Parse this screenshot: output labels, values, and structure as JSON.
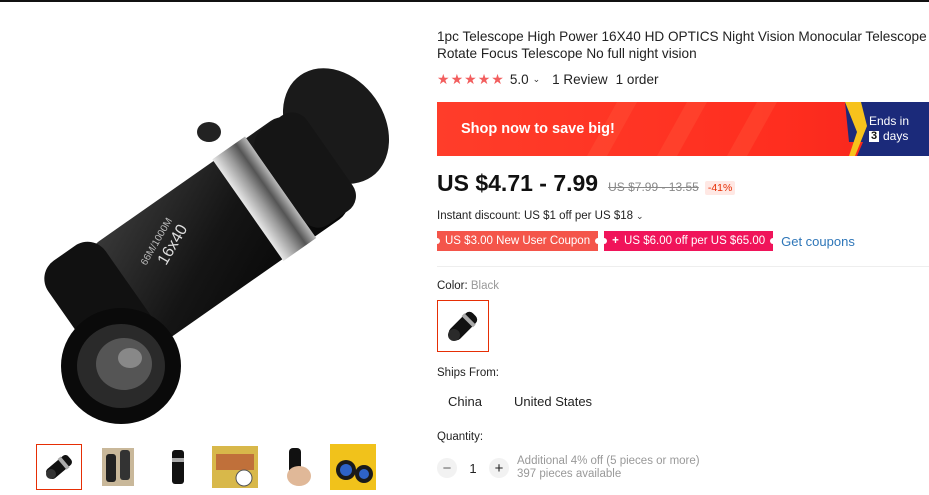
{
  "product": {
    "title": "1pc Telescope High Power 16X40 HD OPTICS Night Vision Monocular Telescope Rotate Focus Telescope No full night vision",
    "rating_score": "5.0",
    "reviews": "1 Review",
    "orders": "1 order"
  },
  "main_image": {
    "lens_text": "16x40",
    "lens_subtext": "66M/1000M"
  },
  "thumbnails": [
    "telescope-front",
    "telescope-pair",
    "telescope-side",
    "telescope-view",
    "telescope-hand",
    "telescope-lens"
  ],
  "promo": {
    "text": "Shop now to save big!",
    "ends_in": "Ends in",
    "days_num": "3",
    "days_label": "days"
  },
  "price": {
    "current": "US $4.71 - 7.99",
    "original": "US $7.99 - 13.55",
    "discount": "-41%"
  },
  "instant_discount": "Instant discount: US $1 off per US $18",
  "coupons": {
    "new_user": "US $3.00 New User Coupon",
    "store_plus": "+",
    "store": "US $6.00 off per US $65.00",
    "get_link": "Get coupons"
  },
  "color": {
    "label": "Color:",
    "value": "Black"
  },
  "ships": {
    "label": "Ships From:",
    "options": [
      "China",
      "United States"
    ]
  },
  "quantity": {
    "label": "Quantity:",
    "value": "1",
    "minus": "−",
    "plus": "+",
    "note1": "Additional 4% off (5 pieces or more)",
    "note2": "397 pieces available"
  },
  "colors": {
    "accent": "#e62e04",
    "banner": "#ff3d2a",
    "coupon_red": "#f4554a",
    "coupon_pink": "#f0145a",
    "link": "#2e76b8",
    "stars": "#f25e5e"
  }
}
